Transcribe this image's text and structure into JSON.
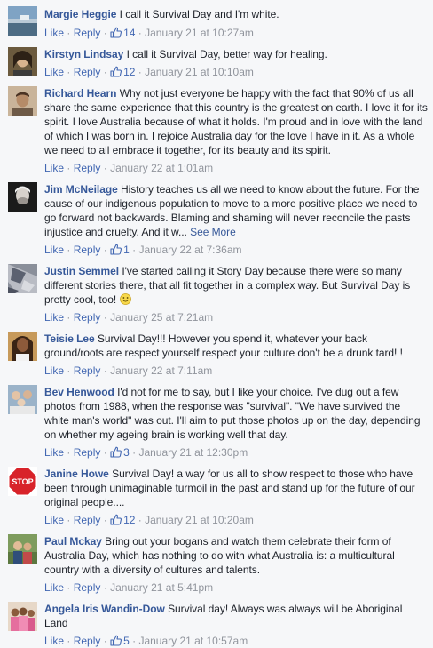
{
  "ui": {
    "like_label": "Like",
    "reply_label": "Reply",
    "separator": "·",
    "see_more_label": "See More",
    "link_color": "#4267b2",
    "author_color": "#365899",
    "muted_color": "#90949c"
  },
  "comments": [
    {
      "author": "Margie Heggie",
      "text": "I call it Survival Day and I'm white.",
      "likes": "14",
      "timestamp": "January 21 at 10:27am",
      "avatar_icon": "avatar-landscape-icon"
    },
    {
      "author": "Kirstyn Lindsay",
      "text": "I call it Survival Day, better way for healing.",
      "likes": "12",
      "timestamp": "January 21 at 10:10am",
      "avatar_icon": "avatar-portrait-icon"
    },
    {
      "author": "Richard Hearn",
      "text": "Why not just everyone be happy with the fact that 90% of us all share the same experience that this country is the greatest on earth. I love it for its spirit. I love Australia because of what it holds. I'm proud and in love with the land of which I was born in. I rejoice Australia day for the love I have in it. As a whole we need to all embrace it together, for its beauty and its spirit.",
      "likes": "",
      "timestamp": "January 22 at 1:01am",
      "avatar_icon": "avatar-portrait-icon"
    },
    {
      "author": "Jim McNeilage",
      "text": "History teaches us all we need to know about the future. For the cause of our indigenous population to move to a more positive place we need to go forward not backwards. Blaming and shaming will never reconcile the pasts injustice and cruelty. And it w...",
      "likes": "1",
      "timestamp": "January 22 at 7:36am",
      "avatar_icon": "avatar-dark-portrait-icon"
    },
    {
      "author": "Justin Semmel",
      "text": "I've started calling it Story Day because there were so many different stories there, that all fit together in a complex way. But Survival Day is pretty cool, too!",
      "likes": "",
      "timestamp": "January 25 at 7:21am",
      "avatar_icon": "avatar-artwork-icon"
    },
    {
      "author": "Teisie Lee",
      "text": "Survival Day!!! However you spend it, whatever your back ground/roots are respect yourself respect your culture don't be a drunk tard! !",
      "likes": "",
      "timestamp": "January 22 at 7:11am",
      "avatar_icon": "avatar-portrait-icon"
    },
    {
      "author": "Bev Henwood",
      "text": "I'd not for me to say, but I like your choice. I've dug out a few photos from 1988, when the response was \"survival\". \"We have survived the white man's world\" was out. I'll aim to put those photos up on the day, depending on whether my ageing brain is working well that day.",
      "likes": "3",
      "timestamp": "January 21 at 12:30pm",
      "avatar_icon": "avatar-group-icon"
    },
    {
      "author": "Janine Howe",
      "text": "Survival Day! a way for us all to show respect to those who have been through unimaginable turmoil in the past and stand up for the future of our original people....",
      "likes": "12",
      "timestamp": "January 21 at 10:20am",
      "avatar_icon": "stop-sign-icon",
      "avatar_text": "STOP"
    },
    {
      "author": "Paul Mckay",
      "text": "Bring out your bogans and watch them celebrate their form of Australia Day, which has nothing to do with what Australia is: a multicultural country with a diversity of cultures and talents.",
      "likes": "",
      "timestamp": "January 21 at 5:41pm",
      "avatar_icon": "avatar-couple-icon"
    },
    {
      "author": "Angela Iris Wandin-Dow",
      "text": "Survival day! Always was always will be Aboriginal Land",
      "likes": "5",
      "timestamp": "January 21 at 10:57am",
      "avatar_icon": "avatar-group-icon"
    }
  ]
}
